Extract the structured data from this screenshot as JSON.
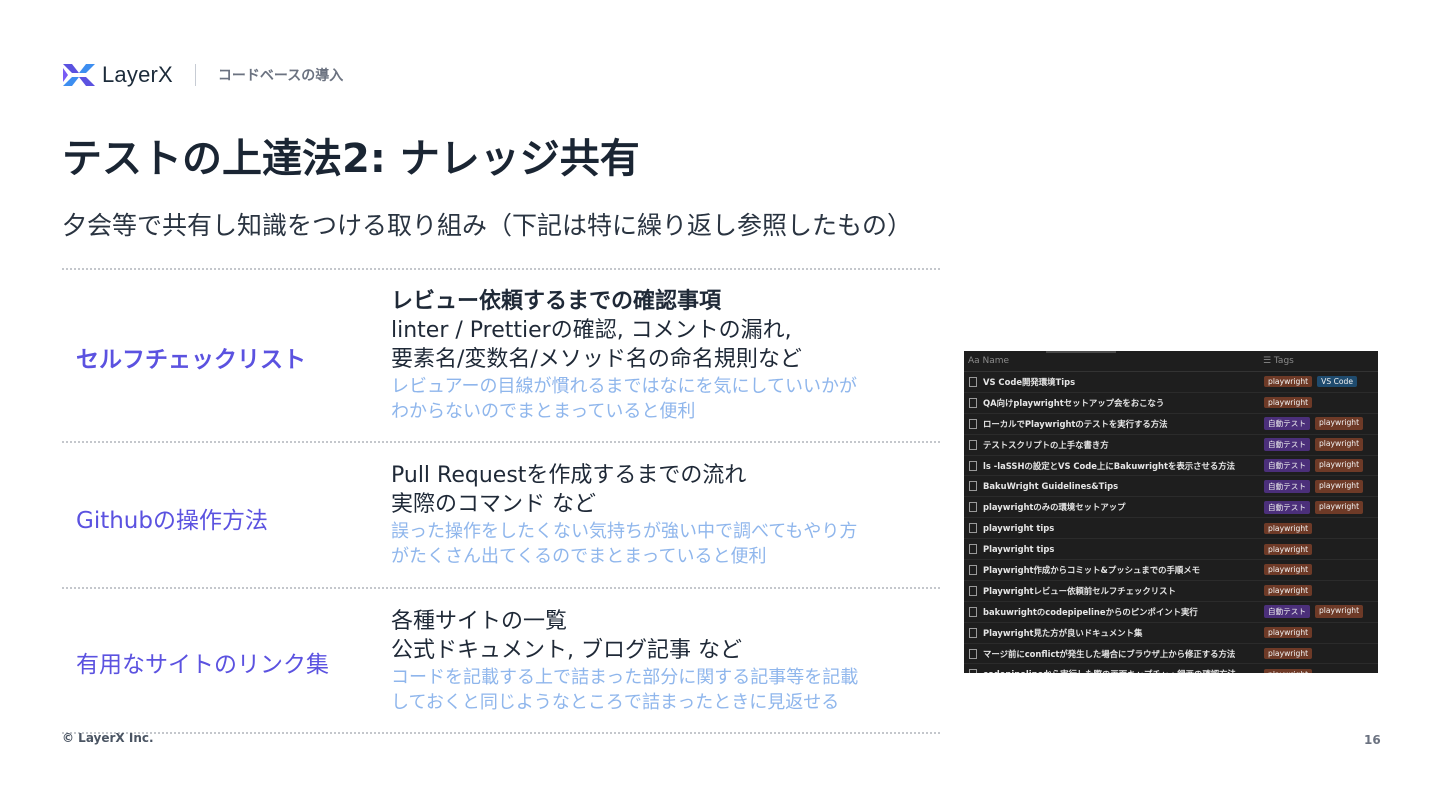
{
  "header": {
    "logo_text": "LayerX",
    "breadcrumb": "コードベースの導入"
  },
  "title": "テストの上達法2: ナレッジ共有",
  "subtitle": "夕会等で共有し知識をつける取り組み（下記は特に繰り返し参照したもの）",
  "rows": [
    {
      "label": "セルフチェックリスト",
      "lines": [
        "レビュー依頼するまでの確認事項",
        "linter / Prettierの確認, コメントの漏れ,",
        "要素名/変数名/メソッド名の命名規則など"
      ],
      "notes": [
        "レビュアーの目線が慣れるまではなにを気にしていいかが",
        "わからないのでまとまっていると便利"
      ]
    },
    {
      "label": "Githubの操作方法",
      "lines": [
        "Pull Requestを作成するまでの流れ",
        "実際のコマンド など"
      ],
      "notes": [
        "誤った操作をしたくない気持ちが強い中で調べてもやり方",
        "がたくさん出てくるのでまとまっていると便利"
      ]
    },
    {
      "label": "有用なサイトのリンク集",
      "lines": [
        "各種サイトの一覧",
        "公式ドキュメント, ブログ記事 など"
      ],
      "notes": [
        "コードを記載する上で詰まった部分に関する記事等を記載",
        "しておくと同じようなところで詰まったときに見返せる"
      ]
    }
  ],
  "screenshot": {
    "col_name": "Aa Name",
    "col_tags": "☰ Tags",
    "items": [
      {
        "name": "VS Code開発環境Tips",
        "tags": [
          "playwright",
          "VS Code"
        ]
      },
      {
        "name": "QA向けplaywrightセットアップ会をおこなう",
        "tags": [
          "playwright"
        ]
      },
      {
        "name": "ローカルでPlaywrightのテストを実行する方法",
        "tags": [
          "自動テスト",
          "playwright"
        ]
      },
      {
        "name": "テストスクリプトの上手な書き方",
        "tags": [
          "自動テスト",
          "playwright"
        ]
      },
      {
        "name": "ls -laSSHの設定とVS Code上にBakuwrightを表示させる方法",
        "tags": [
          "自動テスト",
          "playwright"
        ]
      },
      {
        "name": "BakuWright Guidelines&Tips",
        "tags": [
          "自動テスト",
          "playwright"
        ]
      },
      {
        "name": "playwrightのみの環境セットアップ",
        "tags": [
          "自動テスト",
          "playwright"
        ]
      },
      {
        "name": "playwright tips",
        "tags": [
          "playwright"
        ]
      },
      {
        "name": "Playwright tips",
        "tags": [
          "playwright"
        ]
      },
      {
        "name": "Playwright作成からコミット&プッシュまでの手順メモ",
        "tags": [
          "playwright"
        ]
      },
      {
        "name": "Playwrightレビュー依頼前セルフチェックリスト",
        "tags": [
          "playwright"
        ]
      },
      {
        "name": "bakuwrightのcodepipelineからのピンポイント実行",
        "tags": [
          "自動テスト",
          "playwright"
        ]
      },
      {
        "name": "Playwright見た方が良いドキュメント集",
        "tags": [
          "playwright"
        ]
      },
      {
        "name": "マージ前にconflictが発生した場合にブラウザ上から修正する方法",
        "tags": [
          "playwright"
        ]
      },
      {
        "name": "codepipelineから実行した際の画面キャプチャ・録画の確認方法",
        "tags": [
          "playwright"
        ]
      }
    ]
  },
  "footer": {
    "copyright": "© LayerX Inc.",
    "page_number": "16"
  },
  "colors": {
    "accent": "#5b52e0",
    "note": "#8fb6ec",
    "title": "#1a2533",
    "tag_playwright": "#6e3a27",
    "tag_vscode": "#1f4b6e",
    "tag_auto": "#4b2f7a"
  }
}
